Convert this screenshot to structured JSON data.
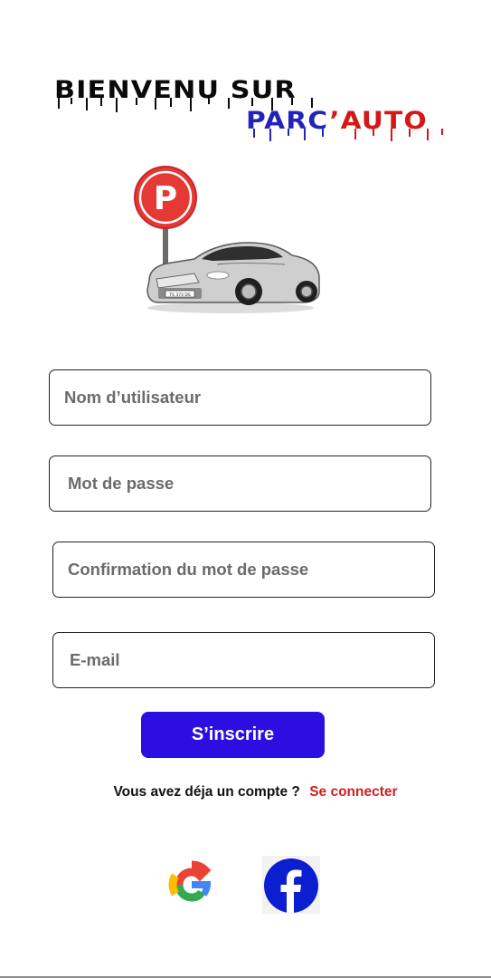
{
  "header": {
    "title_line1": "BIENVENU SUR",
    "title_part_blue": "PARC",
    "title_part_red": "’AUTO"
  },
  "illustration": {
    "sign_letter": "P",
    "plate_text": "TS 373 DS"
  },
  "form": {
    "username": {
      "placeholder": "Nom d’utilisateur",
      "value": ""
    },
    "password": {
      "placeholder": "Mot de passe",
      "value": ""
    },
    "password_confirm": {
      "placeholder": "Confirmation du mot de passe",
      "value": ""
    },
    "email": {
      "placeholder": "E-mail",
      "value": ""
    },
    "submit_label": "S’inscrire"
  },
  "login": {
    "question": "Vous avez déja un compte ?",
    "link_label": "Se connecter"
  },
  "social": {
    "google_icon": "google-icon",
    "facebook_icon": "facebook-icon"
  },
  "colors": {
    "primary_button": "#2a0fe0",
    "link_red": "#cf1f1f",
    "title_blue": "#2323b8",
    "title_red": "#d41717",
    "facebook_blue": "#0b1fd0"
  }
}
